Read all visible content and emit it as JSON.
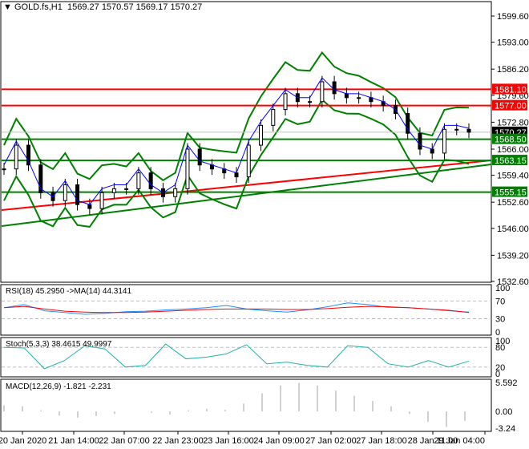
{
  "header": {
    "symbol": "GOLD.fs,H1",
    "open": "1569.27",
    "high": "1570.57",
    "low": "1569.17",
    "close": "1570.27"
  },
  "colors": {
    "bull": "#00ff00",
    "bear": "#000000",
    "resistance": "#ff0000",
    "support": "#008000",
    "current": "#000000",
    "rsi": "#1e90ff",
    "stoch": "#20b2aa"
  },
  "chart_data": [
    {
      "type": "candlestick",
      "title": "GOLD.fs,H1",
      "ylim": [
        1532.6,
        1599.6
      ],
      "y_ticks": [
        "1599.60",
        "1593.00",
        "1586.20",
        "1579.60",
        "1572.80",
        "1566.00",
        "1559.40",
        "1552.60",
        "1546.00",
        "1539.20",
        "1532.60"
      ],
      "x_ticks": [
        "20 Jan 2020",
        "21 Jan 14:00",
        "22 Jan 07:00",
        "22 Jan 23:00",
        "23 Jan 16:00",
        "24 Jan 09:00",
        "27 Jan 02:00",
        "27 Jan 18:00",
        "28 Jan 11:00",
        "29 Jan 04:00"
      ],
      "closes": [
        1561,
        1567,
        1562,
        1555,
        1553,
        1557,
        1552,
        1551,
        1555,
        1556,
        1556,
        1560,
        1556,
        1554,
        1556,
        1566,
        1562,
        1561,
        1560,
        1559,
        1567,
        1572,
        1576,
        1580,
        1578,
        1578,
        1583,
        1580,
        1579,
        1579,
        1578,
        1577,
        1575,
        1570,
        1566,
        1565,
        1571,
        1571,
        1570.27
      ],
      "levels": [
        {
          "value": "1581.10",
          "kind": "resistance"
        },
        {
          "value": "1577.00",
          "kind": "resistance"
        },
        {
          "value": "1570.27",
          "kind": "current"
        },
        {
          "value": "1568.50",
          "kind": "support"
        },
        {
          "value": "1563.15",
          "kind": "support"
        },
        {
          "value": "1555.15",
          "kind": "support"
        }
      ]
    },
    {
      "type": "line",
      "title": "RSI(18) 45.2950 ->MA(14) 44.3141",
      "ylim": [
        0,
        100
      ],
      "y_ticks": [
        "100",
        "70",
        "30",
        "0"
      ],
      "series": [
        {
          "name": "RSI",
          "values": [
            55,
            62,
            48,
            44,
            40,
            42,
            46,
            47,
            50,
            52,
            55,
            60,
            52,
            48,
            45,
            50,
            57,
            66,
            62,
            56,
            55,
            52,
            48,
            45
          ]
        },
        {
          "name": "MA",
          "values": [
            55,
            58,
            52,
            47,
            45,
            44,
            44,
            45,
            47,
            49,
            51,
            52,
            52,
            52,
            51,
            51,
            53,
            56,
            58,
            57,
            55,
            52,
            49,
            44
          ]
        }
      ]
    },
    {
      "type": "line",
      "title": "Stoch(5,3,3) 38.4615 49.9997",
      "ylim": [
        0,
        100
      ],
      "y_ticks": [
        "100",
        "80",
        "20",
        "0"
      ],
      "series": [
        {
          "name": "main",
          "values": [
            80,
            78,
            15,
            40,
            85,
            75,
            20,
            25,
            90,
            45,
            50,
            60,
            88,
            30,
            35,
            25,
            20,
            85,
            80,
            30,
            20,
            40,
            20,
            38
          ]
        }
      ]
    },
    {
      "type": "histogram",
      "title": "MACD(12,26,9) -1.821 -2.231",
      "ylim": [
        -3.24,
        5.592
      ],
      "y_ticks": [
        "5.592",
        "0.00",
        "-3.24"
      ],
      "series": [
        {
          "name": "macd",
          "values": [
            1.2,
            1,
            0.2,
            -0.8,
            -1.2,
            -0.9,
            -0.5,
            0,
            -0.3,
            -0.6,
            0.2,
            0.5,
            0.3,
            1.5,
            3.5,
            5,
            5.5,
            5,
            4,
            3,
            2,
            1,
            -0.5,
            -2,
            -3,
            -1.8
          ]
        }
      ]
    }
  ]
}
